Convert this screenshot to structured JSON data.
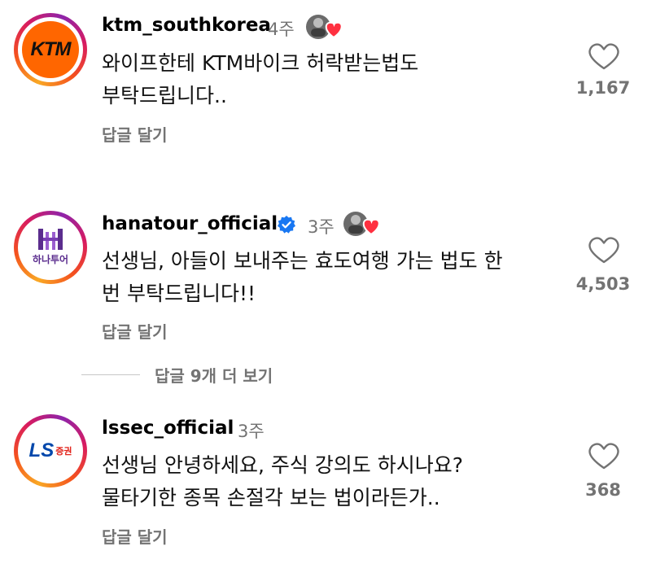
{
  "comments": [
    {
      "username": "ktm_southkorea",
      "time": "4주",
      "verified": false,
      "avatar_text": "KTM",
      "avatar_color": "#ff6600",
      "text_lines": [
        "와이프한테 KTM바이크 허락받는법도",
        "부탁드립니다.."
      ],
      "reply_label": "답글 달기",
      "like_count": "1,167",
      "liked_by_author": true
    },
    {
      "username": "hanatour_official",
      "time": "3주",
      "verified": true,
      "avatar_text": "하나투어",
      "avatar_color": "#5b2d8e",
      "text_lines": [
        "선생님, 아들이 보내주는 효도여행 가는 법도 한",
        "번 부탁드립니다!!"
      ],
      "reply_label": "답글 달기",
      "like_count": "4,503",
      "liked_by_author": true,
      "view_replies_label": "답글 9개 더 보기"
    },
    {
      "username": "lssec_official",
      "time": "3주",
      "verified": false,
      "avatar_text": "LS",
      "avatar_subtext": "증권",
      "avatar_color": "#0047ab",
      "avatar_accent": "#e2231a",
      "text_lines": [
        "선생님 안녕하세요, 주식 강의도 하시나요?",
        "물타기한 종목 손절각 보는 법이라든가.."
      ],
      "reply_label": "답글 달기",
      "like_count": "368",
      "liked_by_author": false
    }
  ],
  "colors": {
    "muted": "#737373",
    "verified_blue": "#1877f2",
    "heart_red": "#ff3040"
  }
}
